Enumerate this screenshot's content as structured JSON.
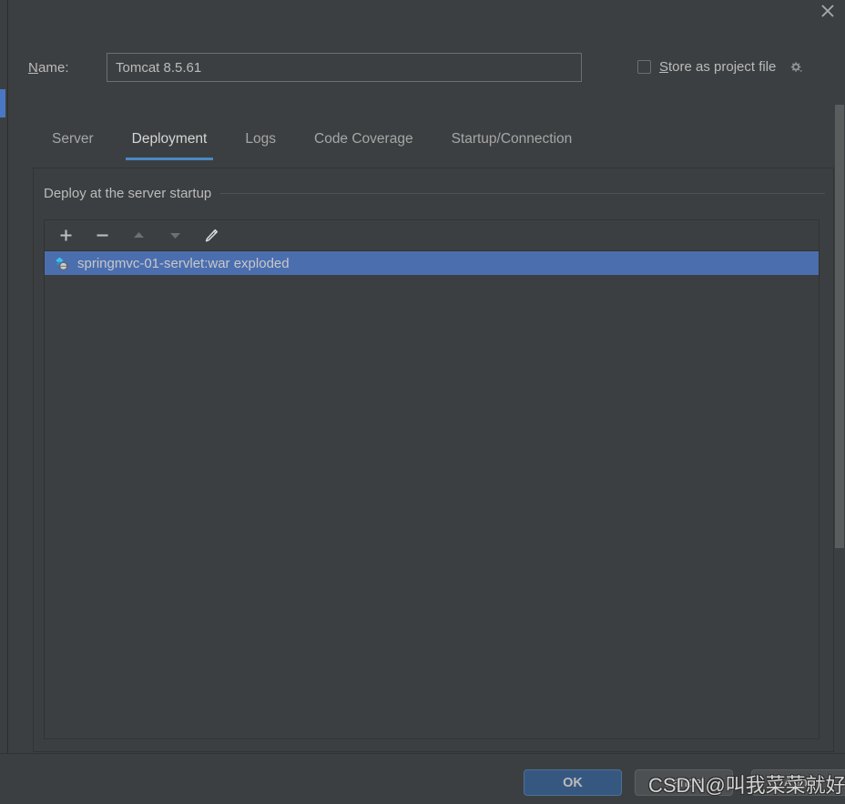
{
  "window": {
    "close_icon": "close-icon"
  },
  "name_field": {
    "label_mnemonic": "N",
    "label_rest": "ame:",
    "value": "Tomcat 8.5.61",
    "placeholder": "Name"
  },
  "store_as_project_file": {
    "label_mnemonic": "S",
    "label_rest": "tore as project file",
    "checked": false,
    "gear_icon": "gear-icon"
  },
  "tabs": [
    {
      "label": "Server",
      "active": false
    },
    {
      "label": "Deployment",
      "active": true
    },
    {
      "label": "Logs",
      "active": false
    },
    {
      "label": "Code Coverage",
      "active": false
    },
    {
      "label": "Startup/Connection",
      "active": false
    }
  ],
  "deployment": {
    "group_title": "Deploy at the server startup",
    "toolbar": [
      {
        "name": "add-button",
        "icon": "plus-icon",
        "enabled": true
      },
      {
        "name": "remove-button",
        "icon": "minus-icon",
        "enabled": true
      },
      {
        "name": "move-up-button",
        "icon": "arrow-up-icon",
        "enabled": false
      },
      {
        "name": "move-down-button",
        "icon": "arrow-down-icon",
        "enabled": false
      },
      {
        "name": "edit-button",
        "icon": "pencil-icon",
        "enabled": true
      }
    ],
    "artifacts": [
      {
        "label": "springmvc-01-servlet:war exploded",
        "icon": "artifact-web-icon",
        "selected": true
      }
    ]
  },
  "buttons": {
    "ok": "OK",
    "cancel": "Cancel",
    "apply": "Apply"
  },
  "watermark": {
    "text": "CSDN@叫我菜菜就好"
  },
  "colors": {
    "dialog_bg": "#3c3f41",
    "accent_blue": "#4a88c7",
    "selection_blue": "#4b6eaf",
    "ok_button_blue": "#365880",
    "text": "#bbbbbb",
    "artifact_icon_cyan": "#40b6e0"
  }
}
